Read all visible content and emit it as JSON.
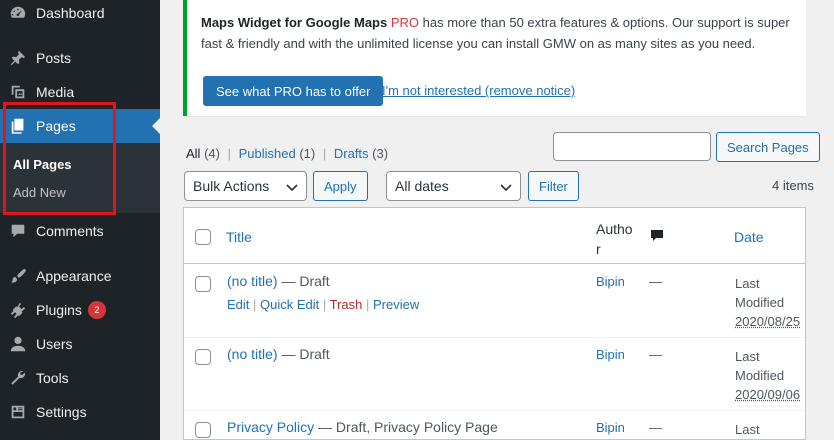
{
  "sidebar": {
    "items": [
      {
        "label": "Dashboard",
        "icon": "dashboard-icon"
      },
      {
        "label": "Posts",
        "icon": "pin-icon"
      },
      {
        "label": "Media",
        "icon": "media-icon"
      },
      {
        "label": "Pages",
        "icon": "pages-icon",
        "active": true
      },
      {
        "label": "Comments",
        "icon": "comment-icon"
      },
      {
        "label": "Appearance",
        "icon": "brush-icon"
      },
      {
        "label": "Plugins",
        "icon": "plugin-icon",
        "badge": "2"
      },
      {
        "label": "Users",
        "icon": "user-icon"
      },
      {
        "label": "Tools",
        "icon": "wrench-icon"
      },
      {
        "label": "Settings",
        "icon": "settings-icon"
      }
    ],
    "submenu": [
      {
        "label": "All Pages",
        "current": true
      },
      {
        "label": "Add New"
      }
    ]
  },
  "notice": {
    "product": "Maps Widget for Google Maps",
    "pro": "PRO",
    "text_line1_rest": " has more than 50 extra features & options. Our support is super",
    "text_line2": "fast & friendly and with the unlimited license you can install GMW on as many sites as you need.",
    "primary_button": "See what PRO has to offer",
    "dismiss_link": "I'm not interested (remove notice)"
  },
  "views": {
    "all_label": "All",
    "all_count": "(4)",
    "published_label": "Published",
    "published_count": "(1)",
    "drafts_label": "Drafts",
    "drafts_count": "(3)",
    "separator": "|"
  },
  "search": {
    "value": "",
    "button": "Search Pages"
  },
  "filters": {
    "bulk_actions": "Bulk Actions",
    "apply": "Apply",
    "dates": "All dates",
    "filter": "Filter",
    "items_count": "4 items"
  },
  "table": {
    "headers": {
      "title": "Title",
      "author_line1": "Autho",
      "author_line2": "r",
      "date": "Date"
    },
    "rows": [
      {
        "title": "(no title)",
        "state": " — Draft",
        "actions": [
          "Edit",
          "Quick Edit",
          "Trash",
          "Preview"
        ],
        "author": "Bipin",
        "comments": "—",
        "date_status": "Last",
        "date_status2": "Modified",
        "date": "2020/08/25"
      },
      {
        "title": "(no title)",
        "state": " — Draft",
        "author": "Bipin",
        "comments": "—",
        "date_status": "Last",
        "date_status2": "Modified",
        "date": "2020/09/06"
      },
      {
        "title": "Privacy Policy",
        "state": " — Draft, Privacy Policy Page",
        "author": "Bipin",
        "comments": "—",
        "date_status": "Last"
      }
    ]
  },
  "colors": {
    "sidebar_bg": "#1d2327",
    "accent": "#2271b1",
    "highlight_box": "#e0161f",
    "notice_border": "#00a32a",
    "badge": "#d63638"
  }
}
